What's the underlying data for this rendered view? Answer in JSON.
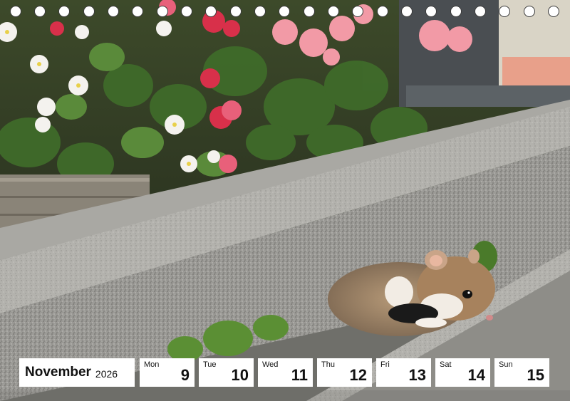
{
  "calendar": {
    "month": "November",
    "year": "2026",
    "days": [
      {
        "name": "Mon",
        "number": "9"
      },
      {
        "name": "Tue",
        "number": "10"
      },
      {
        "name": "Wed",
        "number": "11"
      },
      {
        "name": "Thu",
        "number": "12"
      },
      {
        "name": "Fri",
        "number": "13"
      },
      {
        "name": "Sat",
        "number": "14"
      },
      {
        "name": "Sun",
        "number": "15"
      }
    ]
  }
}
